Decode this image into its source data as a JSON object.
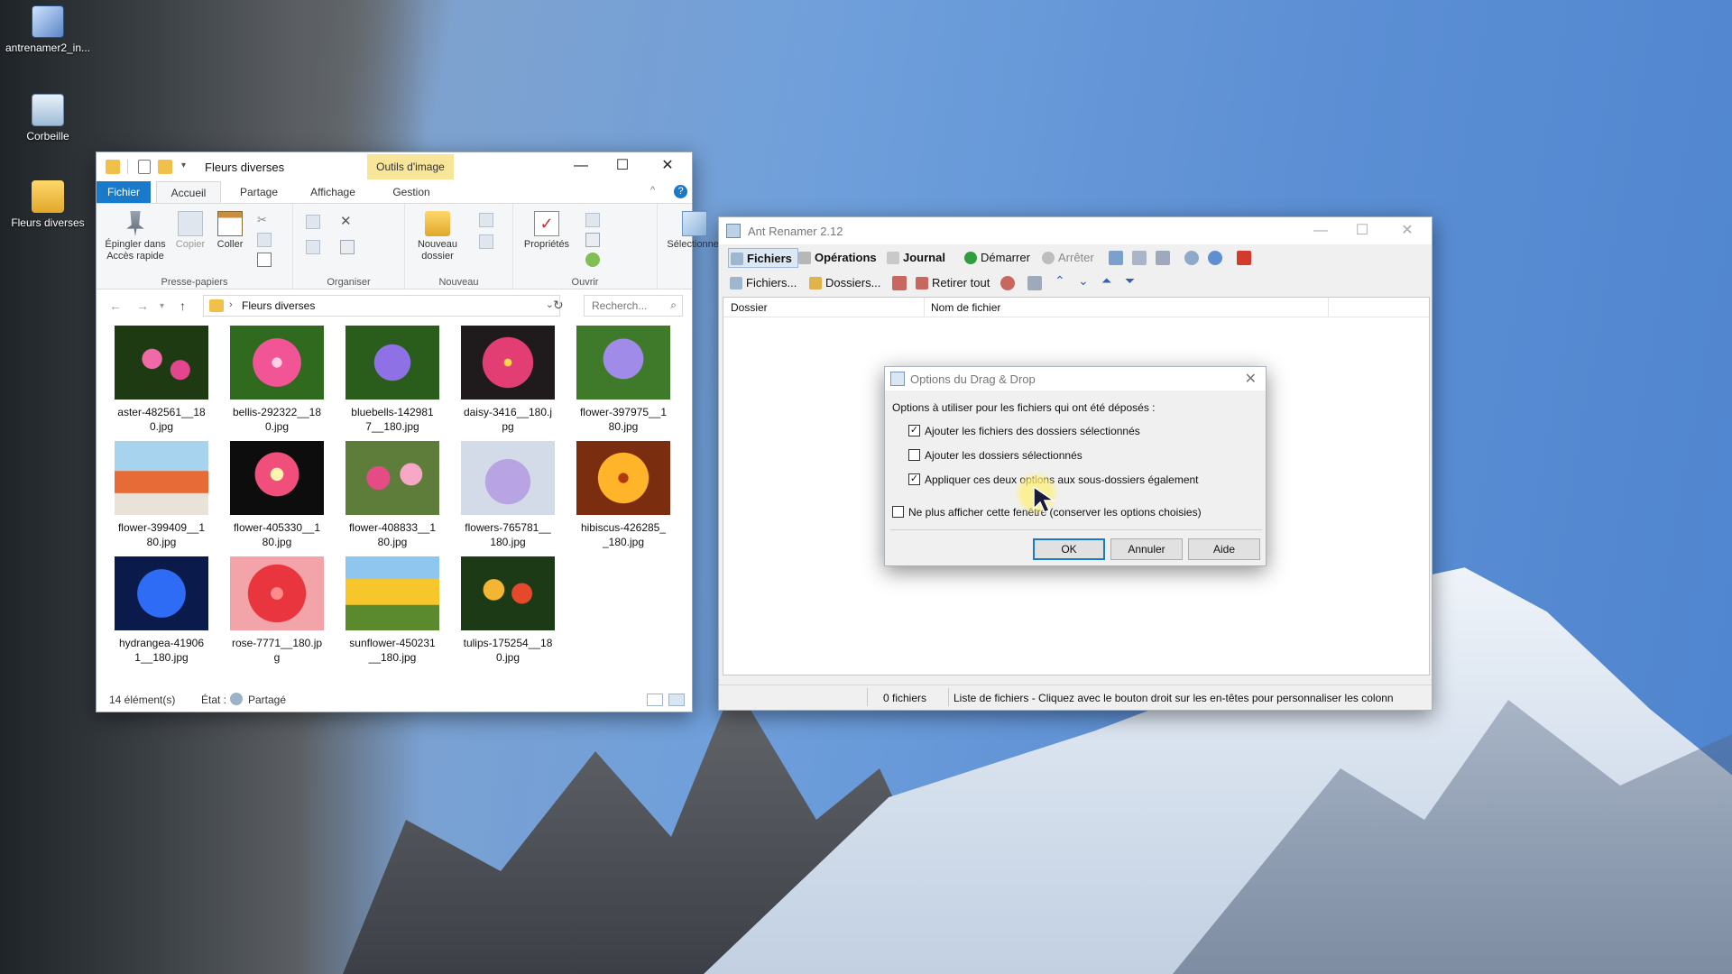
{
  "desktop": {
    "icons": [
      {
        "label": "antrenamer2_in...",
        "icon": "installer-icon"
      },
      {
        "label": "Corbeille",
        "icon": "recycle-bin-icon"
      },
      {
        "label": "Fleurs diverses",
        "icon": "folder-icon"
      }
    ]
  },
  "explorer": {
    "title": "Fleurs diverses",
    "context_tab": "Outils d'image",
    "tabs": {
      "file": "Fichier",
      "home": "Accueil",
      "share": "Partage",
      "view": "Affichage",
      "manage": "Gestion"
    },
    "ribbon": {
      "pin": "Épingler dans Accès rapide",
      "copy": "Copier",
      "paste": "Coller",
      "new_folder": "Nouveau dossier",
      "properties": "Propriétés",
      "select": "Sélectionner",
      "groups": {
        "clipboard": "Presse-papiers",
        "organize": "Organiser",
        "new": "Nouveau",
        "open": "Ouvrir"
      }
    },
    "address": {
      "path": "Fleurs diverses",
      "search_placeholder": "Recherch..."
    },
    "files": [
      {
        "name": "aster-482561__180.jpg",
        "label": "aster-482561__18\n0.jpg"
      },
      {
        "name": "bellis-292322__180.jpg",
        "label": "bellis-292322__18\n0.jpg"
      },
      {
        "name": "bluebells-1429817__180.jpg",
        "label": "bluebells-142981\n7__180.jpg"
      },
      {
        "name": "daisy-3416__180.jpg",
        "label": "daisy-3416__180.j\npg"
      },
      {
        "name": "flower-397975__180.jpg",
        "label": "flower-397975__1\n80.jpg"
      },
      {
        "name": "flower-399409__180.jpg",
        "label": "flower-399409__1\n80.jpg"
      },
      {
        "name": "flower-405330__180.jpg",
        "label": "flower-405330__1\n80.jpg"
      },
      {
        "name": "flower-408833__180.jpg",
        "label": "flower-408833__1\n80.jpg"
      },
      {
        "name": "flowers-765781__180.jpg",
        "label": "flowers-765781__\n180.jpg"
      },
      {
        "name": "hibiscus-426285__180.jpg",
        "label": "hibiscus-426285_\n_180.jpg"
      },
      {
        "name": "hydrangea-419061__180.jpg",
        "label": "hydrangea-41906\n1__180.jpg"
      },
      {
        "name": "rose-7771__180.jpg",
        "label": "rose-7771__180.jp\ng"
      },
      {
        "name": "sunflower-450231__180.jpg",
        "label": "sunflower-450231\n__180.jpg"
      },
      {
        "name": "tulips-175254__180.jpg",
        "label": "tulips-175254__18\n0.jpg"
      }
    ],
    "status": {
      "count": "14 élément(s)",
      "state_label": "État :",
      "state_value": "Partagé"
    }
  },
  "renamer": {
    "title": "Ant Renamer 2.12",
    "toolbar1": {
      "files": "Fichiers",
      "operations": "Opérations",
      "journal": "Journal",
      "start": "Démarrer",
      "stop": "Arrêter"
    },
    "toolbar2": {
      "add_files": "Fichiers...",
      "add_folders": "Dossiers...",
      "remove_all": "Retirer tout"
    },
    "columns": {
      "folder": "Dossier",
      "filename": "Nom de fichier"
    },
    "status": {
      "files": "0 fichiers",
      "hint": "Liste de fichiers - Cliquez avec le bouton droit sur les en-têtes pour personnaliser les colonn"
    }
  },
  "dialog": {
    "title": "Options du Drag & Drop",
    "prompt": "Options à utiliser pour les fichiers qui ont été déposés :",
    "options": [
      {
        "label": "Ajouter les fichiers des dossiers sélectionnés",
        "checked": true
      },
      {
        "label": "Ajouter les dossiers sélectionnés",
        "checked": false
      },
      {
        "label": "Appliquer ces deux options aux sous-dossiers également",
        "checked": true
      }
    ],
    "dont_show": {
      "label": "Ne plus afficher cette fenêtre (conserver les options choisies)",
      "checked": false
    },
    "buttons": {
      "ok": "OK",
      "cancel": "Annuler",
      "help": "Aide"
    }
  }
}
